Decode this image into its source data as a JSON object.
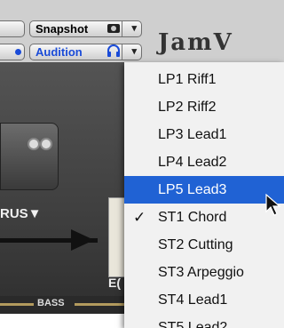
{
  "toolbar": {
    "snapshot_label": "Snapshot",
    "audition_label": "Audition",
    "dropdown_arrow": "▾"
  },
  "brand": {
    "text": "JamV"
  },
  "amp": {
    "chorus_label": "RUS▼",
    "eq_label": "E(",
    "bass_label": "BASS"
  },
  "menu": {
    "items": [
      {
        "label": "LP1 Riff1"
      },
      {
        "label": "LP2 Riff2"
      },
      {
        "label": "LP3 Lead1"
      },
      {
        "label": "LP4 Lead2"
      },
      {
        "label": "LP5 Lead3",
        "state": "highlighted"
      },
      {
        "label": "ST1 Chord",
        "state": "checked",
        "check": "✓"
      },
      {
        "label": "ST2 Cutting"
      },
      {
        "label": "ST3 Arpeggio"
      },
      {
        "label": "ST4 Lead1"
      },
      {
        "label": "ST5 Lead2"
      }
    ]
  },
  "colors": {
    "highlight": "#2062d4",
    "audition_text": "#1a4bd8",
    "menu_bg": "#f1f1f1"
  },
  "icons": [
    "camera-icon",
    "headphones-icon",
    "chevron-down-icon",
    "checkmark-icon",
    "cursor-arrow-icon"
  ]
}
